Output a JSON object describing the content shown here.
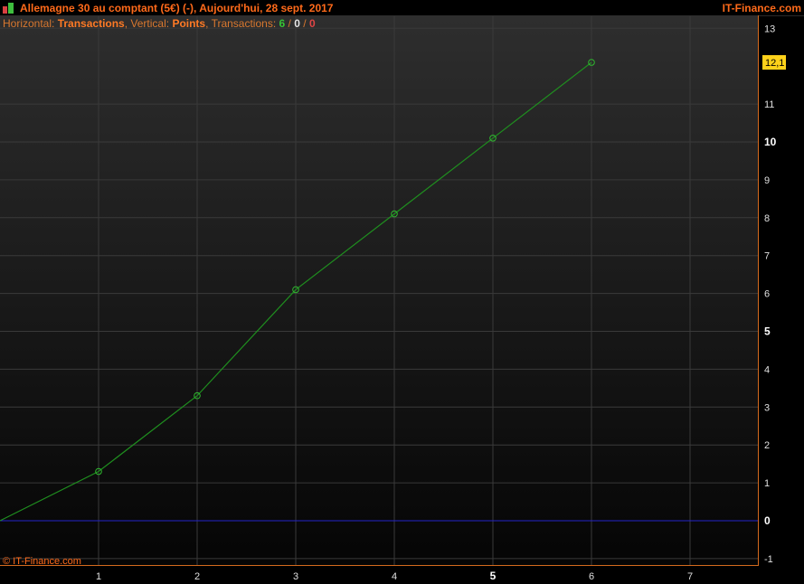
{
  "header": {
    "title": "Allemagne 30 au comptant (5€) (-), Aujourd'hui, 28 sept. 2017",
    "brand": "IT-Finance.com"
  },
  "info": {
    "horizontal_label": "Horizontal:",
    "horizontal_value": "Transactions",
    "vertical_label": "Vertical:",
    "vertical_value": "Points",
    "transactions_label": "Transactions:",
    "count_green": "6",
    "count_white": "0",
    "count_red": "0",
    "separator": "/"
  },
  "footer": {
    "copyright": "© IT-Finance.com"
  },
  "colors": {
    "line": "#1f8f1f",
    "marker": "#2fb82f",
    "zero_line": "#2424c8",
    "grid": "#3a3a3a",
    "badge": "#ffd21a"
  },
  "chart_data": {
    "type": "line",
    "x": [
      0,
      1,
      2,
      3,
      4,
      5,
      6
    ],
    "series": [
      {
        "values": [
          0,
          1.3,
          3.3,
          6.1,
          8.1,
          10.1,
          12.1
        ]
      }
    ],
    "xlim": [
      0,
      7.7
    ],
    "ylim": [
      -1.2,
      13.3
    ],
    "x_ticks": [
      "1",
      "2",
      "3",
      "4",
      "5",
      "6",
      "7"
    ],
    "x_ticks_bold": [
      "5"
    ],
    "y_ticks": [
      "13",
      "11",
      "10",
      "9",
      "8",
      "7",
      "6",
      "5",
      "4",
      "3",
      "2",
      "1",
      "0",
      "-1"
    ],
    "y_ticks_bold": [
      "10",
      "5",
      "0"
    ],
    "last_value_label": "12,1",
    "grid": true
  }
}
